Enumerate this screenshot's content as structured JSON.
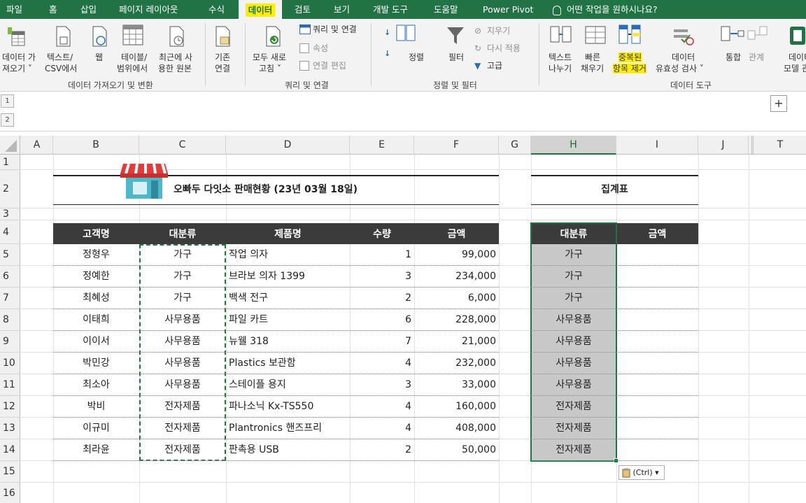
{
  "menu": {
    "tabs": [
      "파일",
      "홈",
      "삽입",
      "페이지 레이아웃",
      "수식",
      "데이터",
      "검토",
      "보기",
      "개발 도구",
      "도움말",
      "Power Pivot"
    ],
    "active_tab": "데이터",
    "tell_me": "어떤 작업을 원하시나요?"
  },
  "ribbon": {
    "get_data": [
      "데이터 가",
      "져오기 ˅"
    ],
    "from_text_csv": [
      "텍스트/",
      "CSV에서"
    ],
    "from_web": "웹",
    "from_table": [
      "테이블/",
      "범위에서"
    ],
    "recent_sources": [
      "최근에 사",
      "용한 원본"
    ],
    "existing_conn": [
      "기존",
      "연결"
    ],
    "group_get_transform": "데이터 가져오기 및 변환",
    "refresh_all": [
      "모두 새로",
      "고침 ˅"
    ],
    "queries_connections": "쿼리 및 연결",
    "properties": "속성",
    "edit_links": "연결 편집",
    "group_queries": "쿼리 및 연결",
    "sort": "정렬",
    "filter": "필터",
    "clear": "지우기",
    "reapply": "다시 적용",
    "advanced": "고급",
    "group_sort_filter": "정렬 및 필터",
    "text_to_columns": [
      "텍스트",
      "나누기"
    ],
    "flash_fill": [
      "빠른",
      "채우기"
    ],
    "remove_duplicates": [
      "중복된",
      "항목 제거"
    ],
    "data_validation": [
      "데이터",
      "유효성 검사 ˅"
    ],
    "consolidate": "통합",
    "relationships": "관계",
    "data_model": [
      "데이터",
      "모델 관"
    ],
    "group_data_tools": "데이터 도구",
    "outline_levels": [
      "1",
      "2"
    ],
    "plus": "+"
  },
  "sheet": {
    "columns": [
      "A",
      "B",
      "C",
      "D",
      "E",
      "F",
      "G",
      "H",
      "I",
      "J",
      "T"
    ],
    "selected_column": "H",
    "rows": [
      "1",
      "2",
      "3",
      "4",
      "5",
      "6",
      "7",
      "8",
      "9",
      "10",
      "11",
      "12",
      "13",
      "14",
      "15",
      "16"
    ],
    "title": "오빠두 다잇소 판매현황 (23년 03월 18일)",
    "summary_title": "집계표",
    "headers": [
      "고객명",
      "대분류",
      "제품명",
      "수량",
      "금액"
    ],
    "summary_headers": [
      "대분류",
      "금액"
    ],
    "data": [
      [
        "정형우",
        "가구",
        "작업 의자",
        "1",
        "99,000"
      ],
      [
        "정예한",
        "가구",
        "브라보 의자 1399",
        "3",
        "234,000"
      ],
      [
        "최혜성",
        "가구",
        "백색 전구",
        "2",
        "6,000"
      ],
      [
        "이태희",
        "사무용품",
        "파일 카트",
        "6",
        "228,000"
      ],
      [
        "이이서",
        "사무용품",
        "뉴웰 318",
        "7",
        "21,000"
      ],
      [
        "박민강",
        "사무용품",
        "Plastics 보관함",
        "4",
        "232,000"
      ],
      [
        "최소아",
        "사무용품",
        "스테이플 용지",
        "3",
        "33,000"
      ],
      [
        "박비",
        "전자제품",
        "파나소닉 Kx-TS550",
        "4",
        "160,000"
      ],
      [
        "이규미",
        "전자제품",
        "Plantronics 핸즈프리",
        "4",
        "408,000"
      ],
      [
        "최라윤",
        "전자제품",
        "판촉용 USB",
        "2",
        "50,000"
      ]
    ],
    "summary_categories": [
      "가구",
      "가구",
      "가구",
      "사무용품",
      "사무용품",
      "사무용품",
      "사무용품",
      "전자제품",
      "전자제품",
      "전자제품"
    ],
    "paste_options": "(Ctrl) ▾"
  },
  "colors": {
    "excel_green": "#217346",
    "highlight": "#ffee00",
    "table_header": "#3b3b3b",
    "selection_fill": "#c8c8c8"
  }
}
